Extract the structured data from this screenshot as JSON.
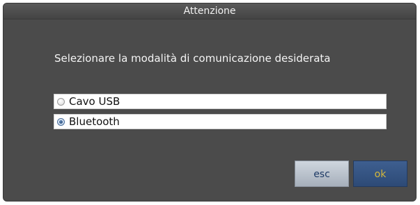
{
  "dialog": {
    "title": "Attenzione",
    "message": "Selezionare la modalità di comunicazione desiderata",
    "options": [
      {
        "label": "Cavo USB",
        "selected": false
      },
      {
        "label": "Bluetooth",
        "selected": true
      }
    ],
    "buttons": {
      "esc_label": "esc",
      "ok_label": "ok"
    }
  },
  "colors": {
    "dialog_background": "#4b4b4b",
    "ok_button": "#2d4a76",
    "ok_text": "#d6b83a",
    "esc_button": "#b9c1cc"
  }
}
